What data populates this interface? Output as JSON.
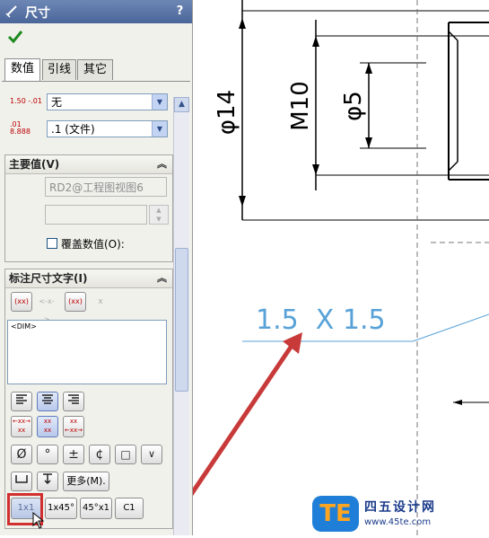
{
  "titlebar": {
    "title": "尺寸",
    "help": "?"
  },
  "tabs": [
    {
      "label": "数值"
    },
    {
      "label": "引线"
    },
    {
      "label": "其它"
    }
  ],
  "tolerance": {
    "tol_icon": "1.50 -.01",
    "tol_value": "无",
    "precision_icon": ".01 8.888",
    "precision_value": ".1 (文件)"
  },
  "primary_value": {
    "header": "主要值(V)",
    "reference": "RD2@工程图视图6",
    "value": "",
    "override_label": "覆盖数值(O):"
  },
  "dim_text": {
    "header": "标注尺寸文字(I)",
    "text_content": "<DIM>",
    "paren_icon": "(xx)",
    "center_icon": "<-x->",
    "box_icon": "(xx)",
    "offset_icon": "x",
    "symbols": [
      "Ø",
      "°",
      "±",
      "¢",
      "□",
      "∨"
    ],
    "more_label": "更多(M).",
    "format_buttons": [
      "1x1",
      "1x45°",
      "45°x1",
      "C1"
    ]
  },
  "drawing": {
    "dim_14": "φ14",
    "dim_m10": "M10",
    "dim_5": "φ5",
    "chamfer": "1.5  X 1.5"
  },
  "logo": {
    "te": "TE",
    "site": "四五设计网",
    "url": "www.45te.com"
  },
  "colors": {
    "title_bar": "#4a6699",
    "accent_red": "#d12f2f",
    "dim_blue": "#58a2d8",
    "logo_blue": "#1f7fd8"
  }
}
